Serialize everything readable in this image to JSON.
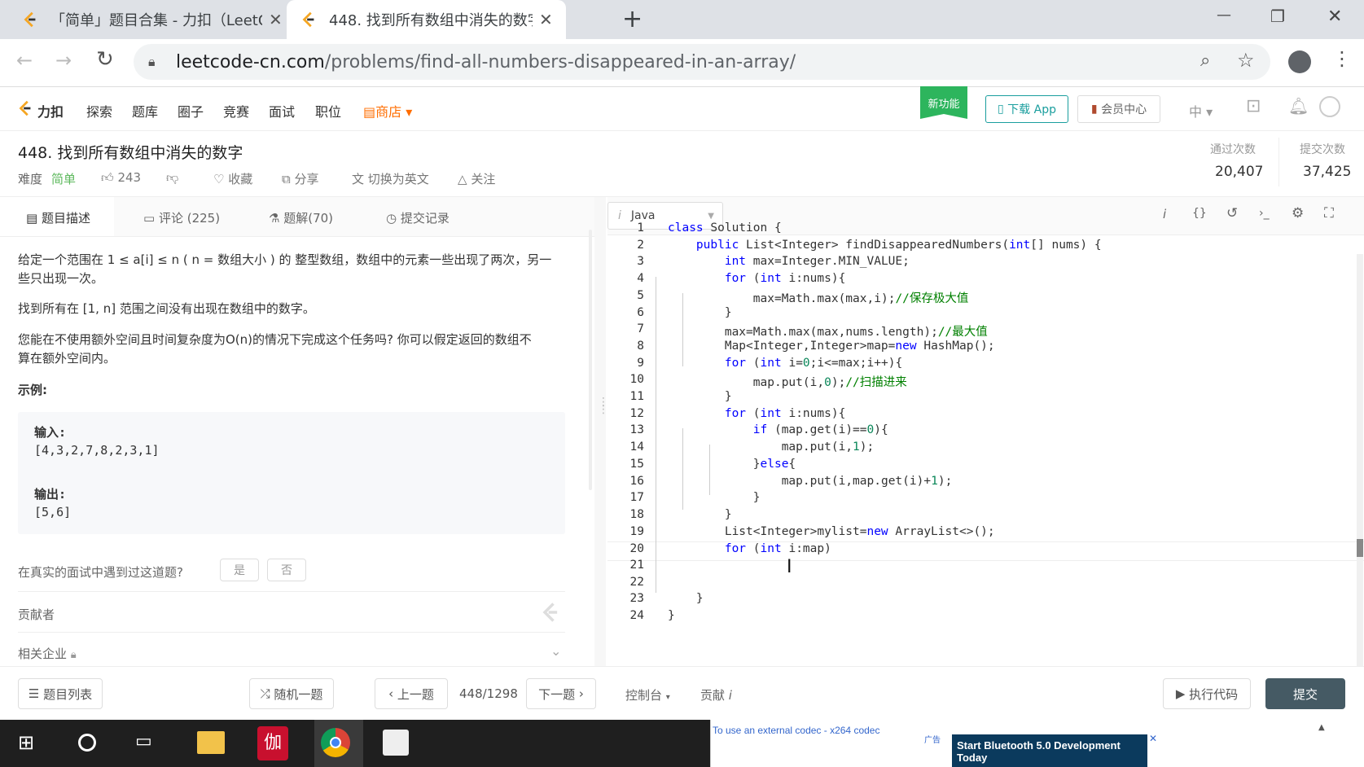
{
  "browser": {
    "tabs": [
      {
        "title": "「简单」题目合集 - 力扣（LeetC",
        "close": "✕"
      },
      {
        "title": "448. 找到所有数组中消失的数字",
        "close": "✕"
      }
    ],
    "new_tab": "+",
    "url_host": "leetcode-cn.com",
    "url_path": "/problems/find-all-numbers-disappeared-in-an-array/",
    "window_controls": [
      "—",
      "❐",
      "✕"
    ]
  },
  "site_nav": {
    "brand": "力扣",
    "items": [
      "探索",
      "题库",
      "圈子",
      "竞赛",
      "面试",
      "职位"
    ],
    "store": "商店",
    "new_feature_badge": "新功能",
    "download_app": "下载 App",
    "vip_center": "会员中心",
    "lang": "中"
  },
  "problem": {
    "title": "448. 找到所有数组中消失的数字",
    "difficulty_label": "难度",
    "difficulty": "简单",
    "likes": "243",
    "favorite": "收藏",
    "share": "分享",
    "switch_lang": "切换为英文",
    "follow": "关注",
    "accepted_label": "通过次数",
    "accepted": "20,407",
    "submissions_label": "提交次数",
    "submissions": "37,425"
  },
  "left_tabs": [
    "题目描述",
    "评论 (225)",
    "题解(70)",
    "提交记录"
  ],
  "description": {
    "p1a": "给定一个范围在  1 ≤ a[i] ≤ n ( n = 数组大小 ) 的 整型数组，数组中的元素一些出现了两次，另一",
    "p1b": "些只出现一次。",
    "p2": "找到所有在 [1, n] 范围之间没有出现在数组中的数字。",
    "p3a": "您能在不使用额外空间且时间复杂度为O(n)的情况下完成这个任务吗? 你可以假定返回的数组不",
    "p3b": "算在额外空间内。",
    "example_title": "示例:",
    "input_label": "输入:",
    "input_value": "[4,3,2,7,8,2,3,1]",
    "output_label": "输出:",
    "output_value": "[5,6]",
    "interview_question": "在真实的面试中遇到过这道题?",
    "yes": "是",
    "no": "否",
    "contributors": "贡献者",
    "companies": "相关企业"
  },
  "editor": {
    "language": "Java",
    "lines": [
      "class Solution {",
      "    public List<Integer> findDisappearedNumbers(int[] nums) {",
      "        int max=Integer.MIN_VALUE;",
      "        for (int i:nums){",
      "            max=Math.max(max,i);//保存极大值",
      "        }",
      "        max=Math.max(max,nums.length);//最大值",
      "        Map<Integer,Integer>map=new HashMap();",
      "        for (int i=0;i<=max;i++){",
      "            map.put(i,0);//扫描进来",
      "        }",
      "        for (int i:nums){",
      "            if (map.get(i)==0){",
      "                map.put(i,1);",
      "            }else{",
      "                map.put(i,map.get(i)+1);",
      "            }",
      "        }",
      "        List<Integer>mylist=new ArrayList<>();",
      "        for (int i:map)",
      "",
      "",
      "    }",
      "}"
    ]
  },
  "bottom": {
    "problem_list": "题目列表",
    "random": "随机一题",
    "prev": "上一题",
    "counter": "448/1298",
    "next": "下一题",
    "console": "控制台",
    "contribute": "贡献",
    "run": "执行代码",
    "submit": "提交"
  },
  "ad": {
    "codec_text": "To use an external codec - x264 codec",
    "ad_label": "广告",
    "banner": "Start Bluetooth 5.0 Development Today"
  },
  "colors": {
    "leetcode_orange": "#ffa116",
    "easy_green": "#5cb85c",
    "new_badge": "#2db55d",
    "teal": "#1a9e9e",
    "submit_bg": "#455a64"
  }
}
